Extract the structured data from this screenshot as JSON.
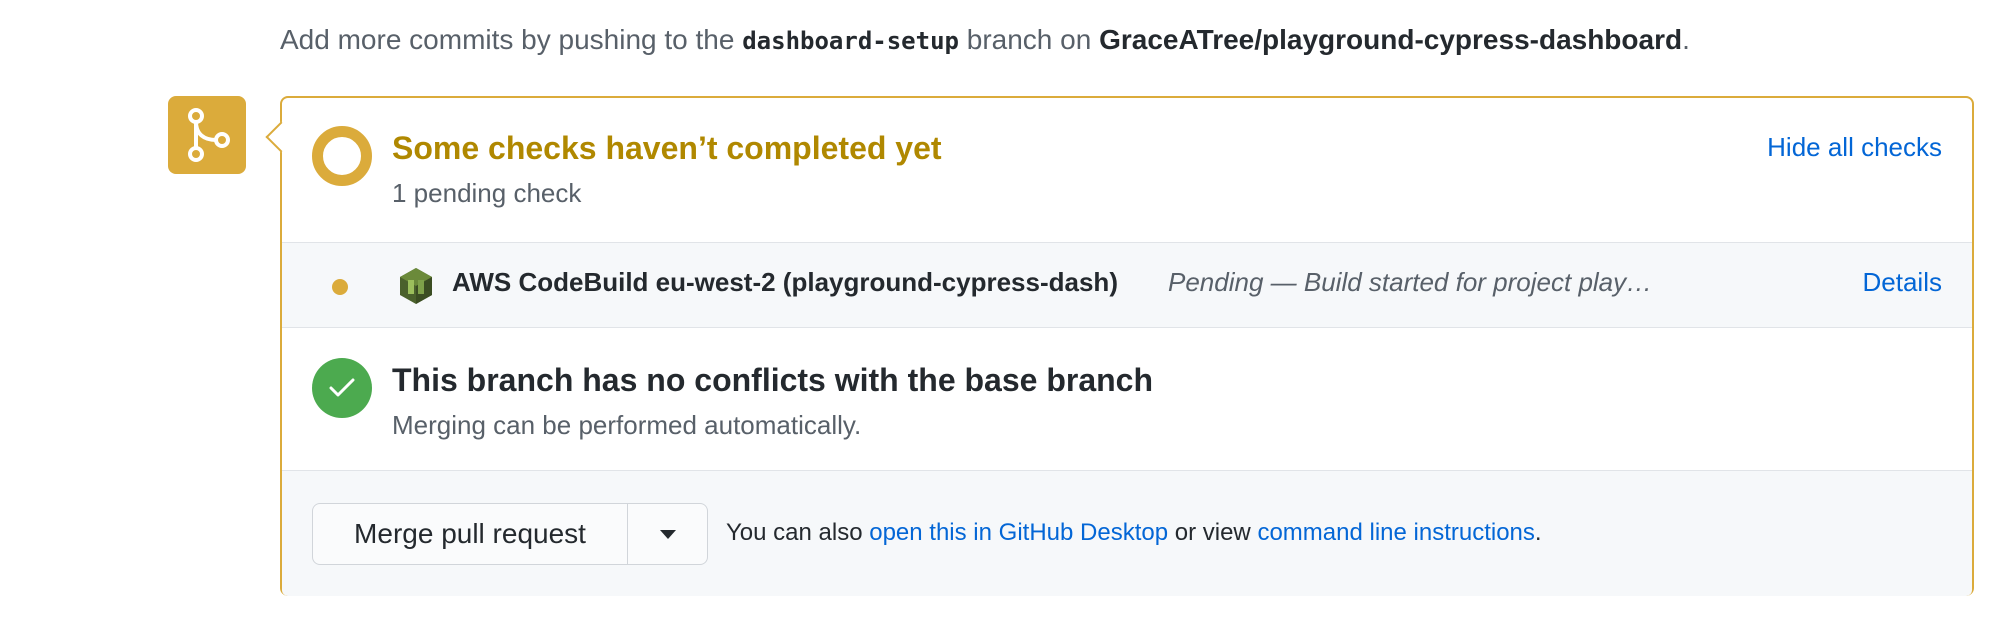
{
  "hint": {
    "prefix": "Add more commits by pushing to the",
    "branch": "dashboard-setup",
    "middle": "branch on",
    "repo": "GraceATree/playground-cypress-dashboard",
    "suffix": "."
  },
  "checks": {
    "title": "Some checks haven’t completed yet",
    "subtitle": "1 pending check",
    "toggle_label": "Hide all checks",
    "items": [
      {
        "name": "AWS CodeBuild eu-west-2 (playground-cypress-dash)",
        "description": "Pending — Build started for project play…",
        "details_label": "Details",
        "icon": "aws-codebuild-icon"
      }
    ]
  },
  "conflicts": {
    "title": "This branch has no conflicts with the base branch",
    "subtitle": "Merging can be performed automatically."
  },
  "actions": {
    "merge_label": "Merge pull request",
    "also_prefix": "You can also",
    "desktop_link": "open this in GitHub Desktop",
    "or_view": "or view",
    "cli_link": "command line instructions",
    "suffix": "."
  },
  "colors": {
    "pending": "#dbab3b",
    "pending_text": "#b08800",
    "success": "#4caa4f",
    "link": "#0366d6"
  }
}
